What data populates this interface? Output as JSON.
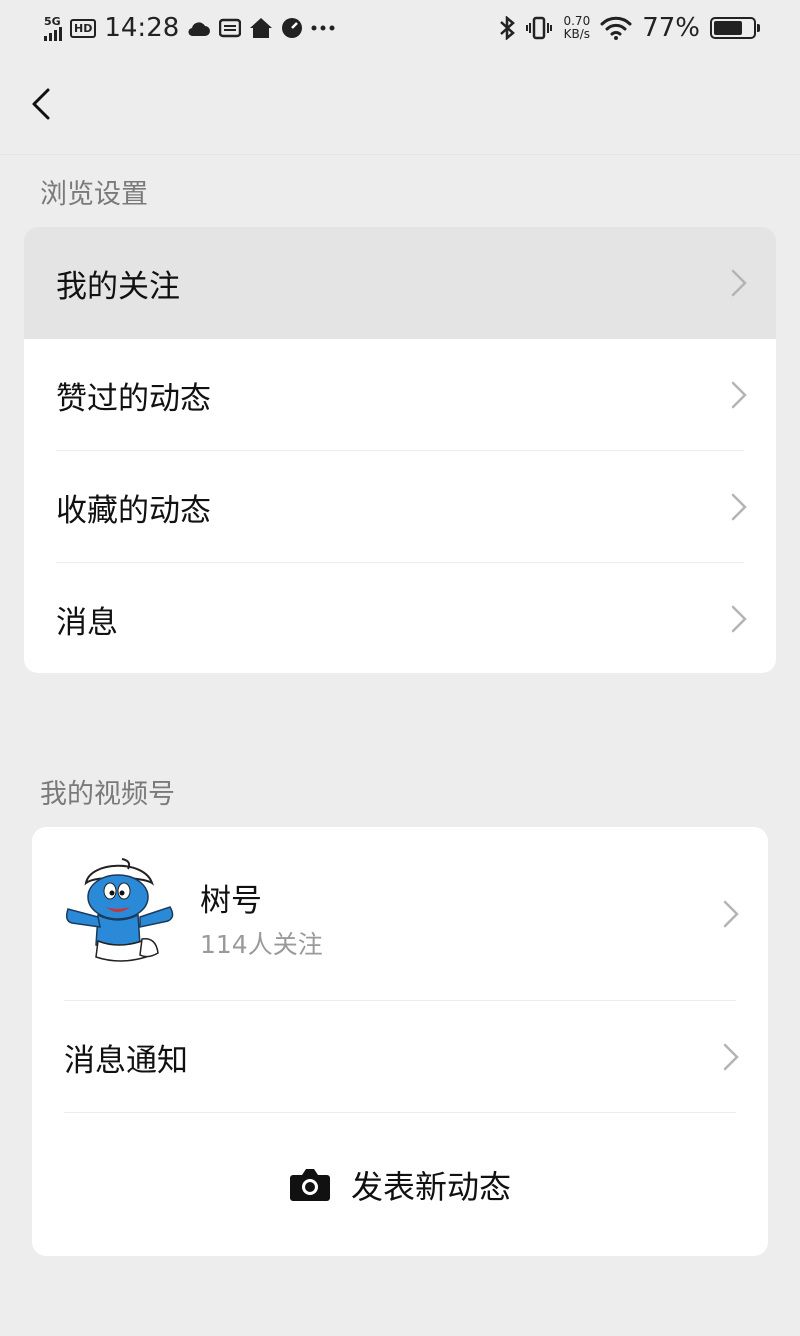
{
  "status_bar": {
    "network": "5G",
    "hd": "HD",
    "time": "14:28",
    "speed_value": "0.70",
    "speed_unit": "KB/s",
    "battery": "77%"
  },
  "sections": {
    "browse": {
      "title": "浏览设置",
      "items": [
        {
          "label": "我的关注"
        },
        {
          "label": "赞过的动态"
        },
        {
          "label": "收藏的动态"
        },
        {
          "label": "消息"
        }
      ]
    },
    "channel": {
      "title": "我的视频号",
      "profile": {
        "name": "树号",
        "followers": "114人关注"
      },
      "notify_label": "消息通知",
      "publish_label": "发表新动态"
    }
  },
  "colors": {
    "background": "#ededed",
    "card": "#ffffff",
    "pressed": "#e4e4e4",
    "secondary_text": "#7a7a7a",
    "avatar_blue": "#2b8ad8"
  }
}
